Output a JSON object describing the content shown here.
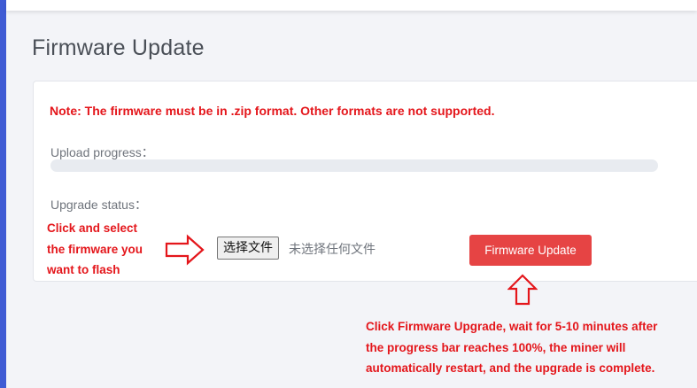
{
  "page": {
    "title": "Firmware Update"
  },
  "card": {
    "note": "Note: The firmware must be in .zip format. Other formats are not supported.",
    "upload_progress_label": "Upload progress：",
    "upload_progress_value": 0,
    "upgrade_status_label": "Upgrade status：",
    "file_input": {
      "button_label": "选择文件",
      "status_text": "未选择任何文件"
    },
    "update_button_label": "Firmware Update"
  },
  "annotations": {
    "left_lines": [
      "Click and select",
      "the firmware you",
      "want to flash"
    ],
    "bottom_lines": [
      "Click Firmware Upgrade, wait for 5-10 minutes after",
      "the progress bar reaches 100%, the miner will",
      "automatically restart, and the upgrade is complete."
    ],
    "color": "#e4161b"
  },
  "colors": {
    "accent": "#3f5bd4",
    "danger": "#e64444",
    "annotation": "#e4161b"
  },
  "icons": [
    "arrow-right-icon",
    "arrow-up-icon"
  ]
}
